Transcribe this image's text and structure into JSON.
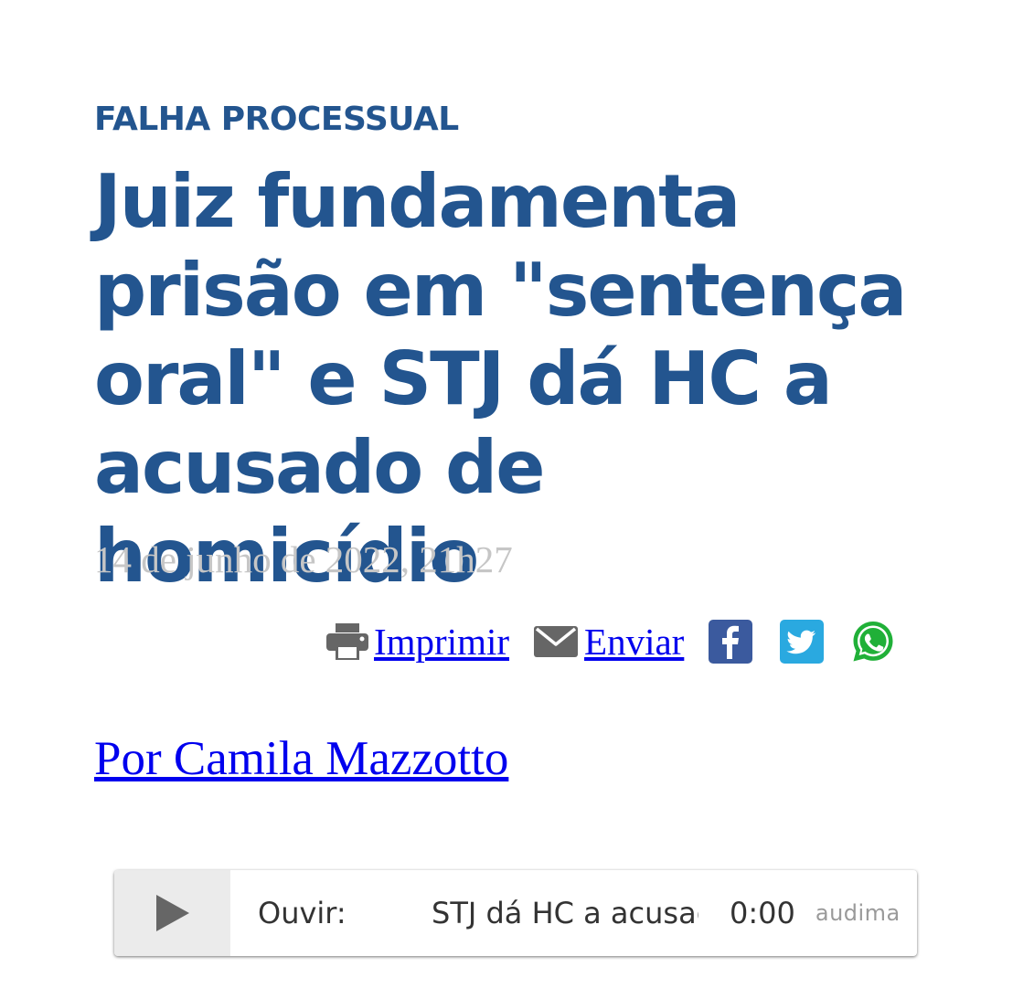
{
  "article": {
    "kicker": "FALHA PROCESSUAL",
    "headline": "Juiz fundamenta prisão em \"sentença oral\" e STJ dá HC a acusado de homicídio",
    "date": "14 de junho de 2022, 21h27",
    "byline": "Por Camila Mazzotto"
  },
  "share": {
    "print_label": "Imprimir",
    "send_label": "Enviar",
    "icons": [
      "print-icon",
      "mail-icon",
      "facebook-icon",
      "twitter-icon",
      "whatsapp-icon"
    ]
  },
  "player": {
    "label": "Ouvir:",
    "track": "STJ dá HC a acusado de homicídio",
    "time": "0:00",
    "brand": "audima"
  },
  "colors": {
    "headline": "#23558f",
    "date": "#c6c6c6",
    "link": "#0000ee",
    "icon_gray": "#666666",
    "facebook": "#3b5a9e",
    "twitter": "#2aa9e0",
    "whatsapp": "#20b038"
  }
}
